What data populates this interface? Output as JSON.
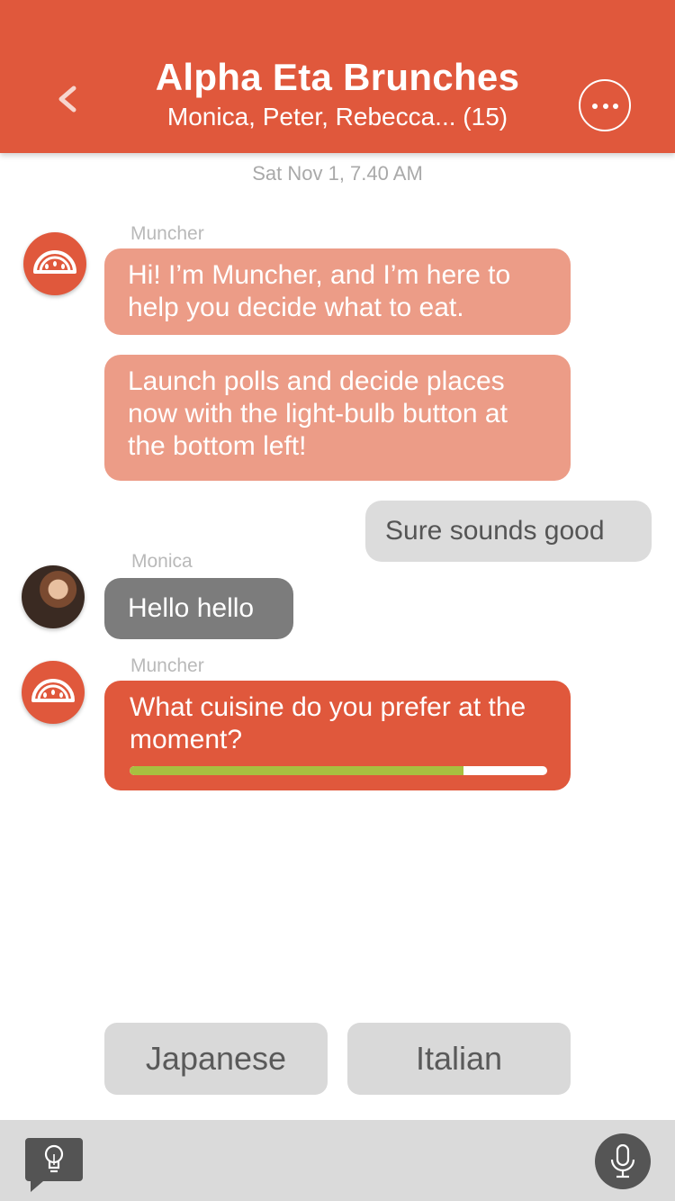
{
  "header": {
    "title": "Alpha Eta Brunches",
    "subtitle": "Monica, Peter, Rebecca... (15)",
    "back_icon": "chevron-left-icon",
    "more_icon": "ellipsis-icon"
  },
  "chat": {
    "timestamp": "Sat Nov 1, 7.40 AM",
    "messages": [
      {
        "sender": "Muncher",
        "text": "Hi! I’m Muncher, and I’m here to help you decide what to eat."
      },
      {
        "text": "Launch polls and decide places now with the light-bulb button at the bottom left!"
      },
      {
        "text": "Sure sounds good"
      },
      {
        "sender": "Monica",
        "text": "Hello hello"
      },
      {
        "sender": "Muncher",
        "text": "What cuisine do you prefer at the moment?",
        "progress": 0.8
      }
    ]
  },
  "poll": {
    "options": [
      "Japanese",
      "Italian"
    ]
  },
  "footer": {
    "bulb_icon": "light-bulb-icon",
    "mic_icon": "microphone-icon"
  },
  "colors": {
    "brand": "#E0583C",
    "bot_bubble": "#EC9C87",
    "user_bubble": "#DCDCDC",
    "friend_bubble": "#7C7C7C",
    "progress": "#A8C040"
  }
}
